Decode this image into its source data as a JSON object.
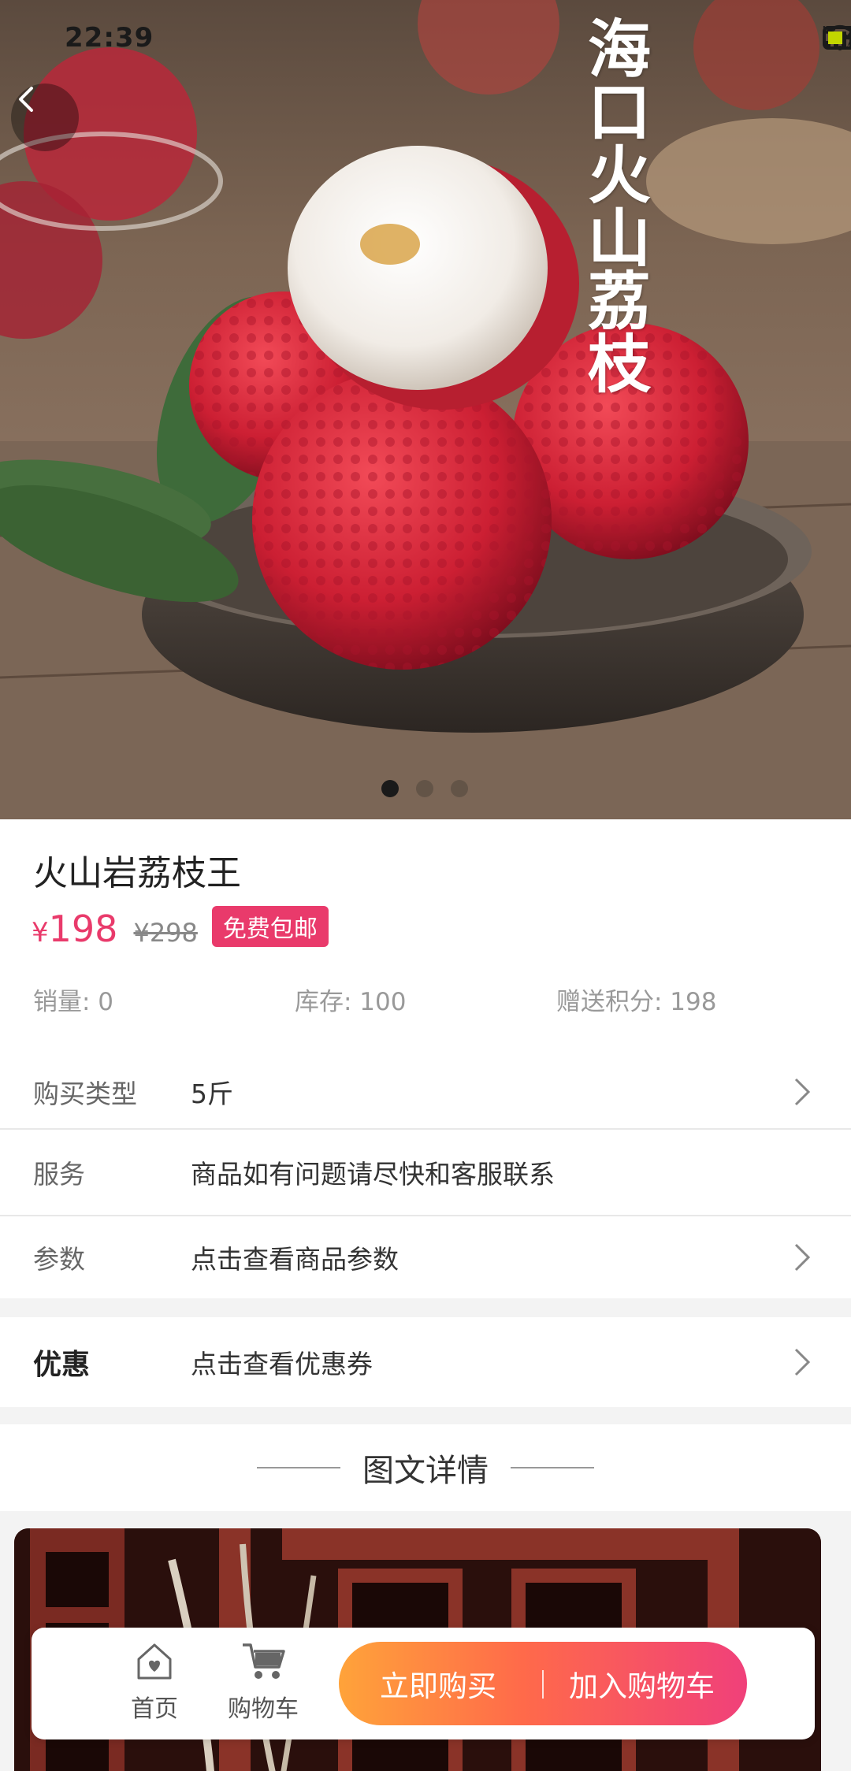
{
  "status_bar": {
    "time": "22:39",
    "network_label": "HD"
  },
  "hero": {
    "vertical_title": "海口火山荔枝",
    "slide_count": 3,
    "active_slide": 1
  },
  "product": {
    "title": "火山岩荔枝王",
    "currency": "¥",
    "price": "198",
    "original_price": "¥298",
    "badge": "免费包邮",
    "sales": "销量: 0",
    "stock": "库存: 100",
    "points": "赠送积分: 198"
  },
  "rows": {
    "buy_type": {
      "label": "购买类型",
      "value": "5斤"
    },
    "service": {
      "label": "服务",
      "value": "商品如有问题请尽快和客服联系"
    },
    "params": {
      "label": "参数",
      "value": "点击查看商品参数"
    },
    "coupon": {
      "label": "优惠",
      "value": "点击查看优惠券"
    }
  },
  "detail": {
    "heading": "图文详情"
  },
  "bottom_bar": {
    "home_label": "首页",
    "cart_label": "购物车",
    "buy_now": "立即购买",
    "add_to_cart": "加入购物车"
  },
  "colors": {
    "accent": "#e93a6b",
    "gradient_start": "#ffa33a",
    "gradient_end": "#f0407a"
  }
}
